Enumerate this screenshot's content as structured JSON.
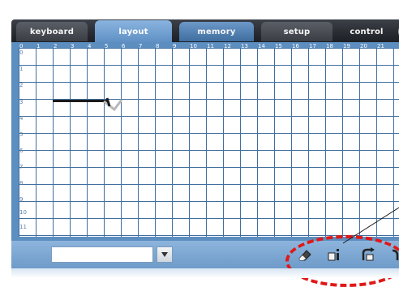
{
  "tabs": [
    {
      "label": "keyboard",
      "state": "dark"
    },
    {
      "label": "layout",
      "state": "active"
    },
    {
      "label": "memory",
      "state": "blue"
    },
    {
      "label": "setup",
      "state": "dark"
    },
    {
      "label": "control",
      "state": "plain"
    }
  ],
  "grid": {
    "columns": [
      "0",
      "1",
      "2",
      "3",
      "4",
      "5",
      "6",
      "7",
      "8",
      "9",
      "10",
      "11",
      "12",
      "13",
      "14",
      "15",
      "16",
      "17",
      "18",
      "19",
      "20",
      "21"
    ],
    "rows": [
      "0",
      "1",
      "2",
      "3",
      "4",
      "5",
      "6",
      "7",
      "8",
      "9",
      "10",
      "11"
    ]
  },
  "toolbar": {
    "select_value": "",
    "dropdown_icon": "chevron-down-icon",
    "buttons": [
      {
        "name": "erase-icon"
      },
      {
        "name": "info-icon"
      },
      {
        "name": "rotate-icon"
      },
      {
        "name": "next-icon"
      }
    ]
  },
  "colors": {
    "tab_active": "#8ab4e0",
    "panel": "#5c8ec0",
    "grid_line": "#3f6e9f",
    "highlight": "#e01818"
  }
}
